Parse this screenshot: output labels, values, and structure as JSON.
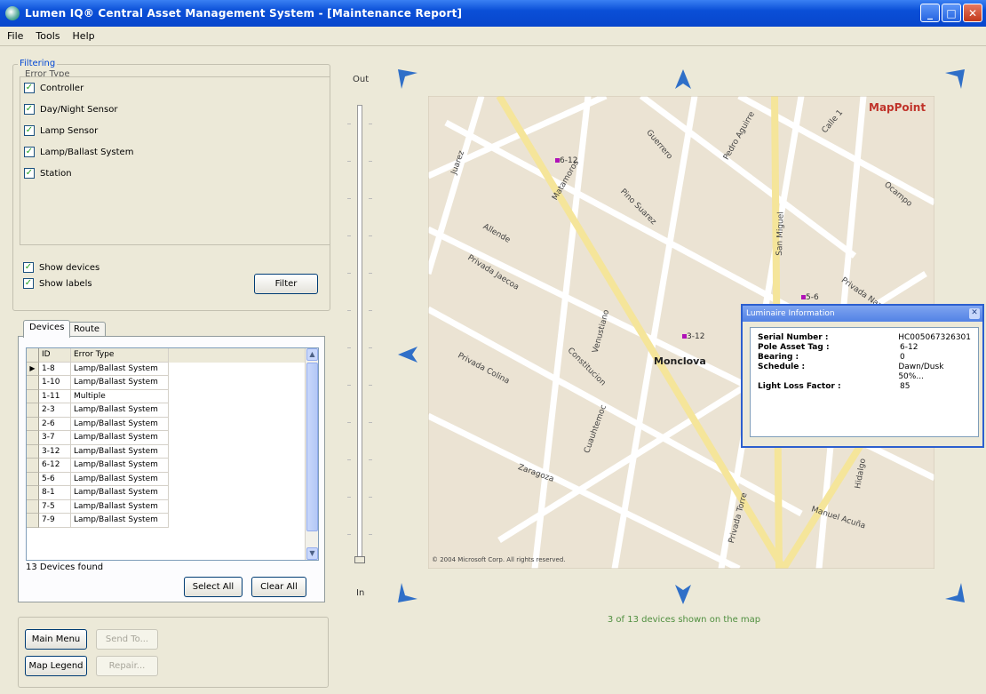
{
  "window": {
    "title": "Lumen IQ® Central Asset Management System - [Maintenance Report]",
    "controls": [
      "_",
      "□",
      "✕"
    ]
  },
  "menu": [
    "File",
    "Tools",
    "Help"
  ],
  "filtering": {
    "group_label": "Filtering",
    "error_type_label": "Error Type",
    "error_types": [
      {
        "label": "Controller",
        "checked": true
      },
      {
        "label": "Day/Night Sensor",
        "checked": true
      },
      {
        "label": "Lamp Sensor",
        "checked": true
      },
      {
        "label": "Lamp/Ballast System",
        "checked": true
      },
      {
        "label": "Station",
        "checked": true
      }
    ],
    "show_devices": "Show devices",
    "show_labels": "Show labels",
    "filter_button": "Filter"
  },
  "tabs": {
    "devices": "Devices",
    "route": "Route"
  },
  "devices_table": {
    "columns": [
      "ID",
      "Error Type"
    ],
    "rows": [
      {
        "id": "1-8",
        "error": "Lamp/Ballast System"
      },
      {
        "id": "1-10",
        "error": "Lamp/Ballast System"
      },
      {
        "id": "1-11",
        "error": "Multiple"
      },
      {
        "id": "2-3",
        "error": "Lamp/Ballast System"
      },
      {
        "id": "2-6",
        "error": "Lamp/Ballast System"
      },
      {
        "id": "3-7",
        "error": "Lamp/Ballast System"
      },
      {
        "id": "3-12",
        "error": "Lamp/Ballast System"
      },
      {
        "id": "6-12",
        "error": "Lamp/Ballast System"
      },
      {
        "id": "5-6",
        "error": "Lamp/Ballast System"
      },
      {
        "id": "8-1",
        "error": "Lamp/Ballast System"
      },
      {
        "id": "7-5",
        "error": "Lamp/Ballast System"
      },
      {
        "id": "7-9",
        "error": "Lamp/Ballast System"
      }
    ],
    "found_text": "13 Devices found",
    "select_all": "Select All",
    "clear_all": "Clear All"
  },
  "bottom_buttons": {
    "main_menu": "Main Menu",
    "send_to": "Send To...",
    "map_legend": "Map Legend",
    "repair": "Repair..."
  },
  "zoom": {
    "out_label": "Out",
    "in_label": "In"
  },
  "map": {
    "brand": "MapPoint",
    "city_label": "Monclova",
    "copyright": "© 2004 Microsoft Corp. All rights reserved.",
    "streets": [
      "Juarez",
      "Matamoros",
      "Pino Suarez",
      "Calle 1",
      "Ocampo",
      "Pedro Aguirre",
      "Guerrero",
      "Privada Jaecoa",
      "Privada Colina",
      "Constitucion",
      "Privada Nazas",
      "Venustiano",
      "San Miguel",
      "Manuel Acuña",
      "Privada Torre",
      "Hidalgo",
      "Cuauhtemoc",
      "Zaragoza",
      "Allende"
    ],
    "devices": [
      "6-12",
      "3-12",
      "5-6"
    ]
  },
  "info_window": {
    "title": "Luminaire Information",
    "fields": [
      {
        "key": "Serial Number :",
        "value": "HC005067326301"
      },
      {
        "key": "Pole Asset Tag :",
        "value": "6-12"
      },
      {
        "key": "Bearing :",
        "value": "0"
      },
      {
        "key": "Schedule :",
        "value": "Dawn/Dusk 50%..."
      },
      {
        "key": "Light Loss Factor :",
        "value": "85"
      }
    ]
  },
  "status_text": "3 of 13 devices shown on the map",
  "colors": {
    "title_bar": "#0a4fd7",
    "nav_arrow": "#2f6fc8",
    "map_bg": "#ebe3d3",
    "main_road": "#f5e59a",
    "device_marker": "#b012b7",
    "status_text": "#4f8f3f"
  }
}
